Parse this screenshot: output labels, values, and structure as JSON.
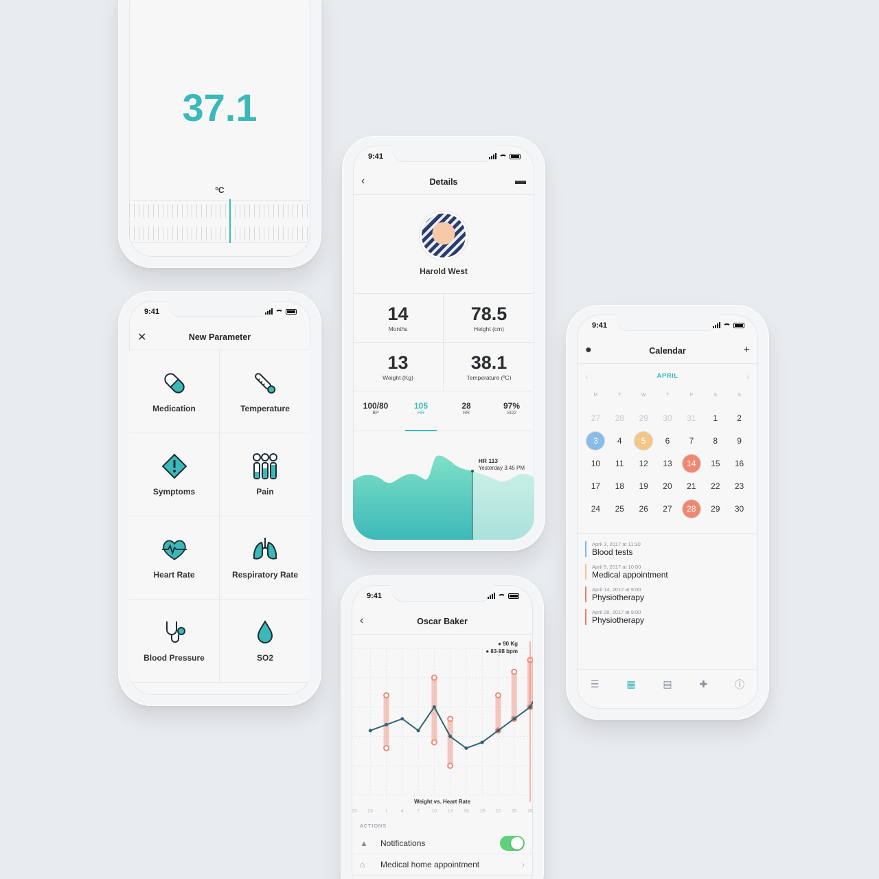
{
  "status_time": "9:41",
  "colors": {
    "accent": "#3bb8b8",
    "coral": "#f08a78",
    "dark_line": "#2f6476",
    "toggle": "#5fd17a"
  },
  "thermometer": {
    "value": "37.1",
    "unit": "ºC"
  },
  "new_parameter": {
    "title": "New Parameter",
    "close_icon": "close-icon",
    "items": [
      {
        "label": "Medication",
        "icon": "pill-icon"
      },
      {
        "label": "Temperature",
        "icon": "thermometer-icon"
      },
      {
        "label": "Symptoms",
        "icon": "warning-icon"
      },
      {
        "label": "Pain",
        "icon": "pain-scale-icon"
      },
      {
        "label": "Heart Rate",
        "icon": "heart-rate-icon"
      },
      {
        "label": "Respiratory Rate",
        "icon": "lungs-icon"
      },
      {
        "label": "Blood Pressure",
        "icon": "stethoscope-icon"
      },
      {
        "label": "SO2",
        "icon": "drop-icon"
      }
    ]
  },
  "details": {
    "title": "Details",
    "patient_name": "Harold West",
    "stats": [
      {
        "value": "14",
        "label": "Months"
      },
      {
        "value": "78.5",
        "label": "Height (cm)"
      },
      {
        "value": "13",
        "label": "Weight (Kg)"
      },
      {
        "value": "38.1",
        "label": "Temperature (ºC)"
      }
    ],
    "vitals": [
      {
        "value": "100/80",
        "label": "BP"
      },
      {
        "value": "105",
        "label": "HR"
      },
      {
        "value": "28",
        "label": "RR"
      },
      {
        "value": "97%",
        "label": "SO2"
      }
    ],
    "hr_marker": {
      "label": "HR 113",
      "time": "Yesterday 3:45 PM"
    }
  },
  "calendar": {
    "title": "Calendar",
    "month": "APRIL",
    "weekdays": [
      "M",
      "T",
      "W",
      "T",
      "F",
      "S",
      "S"
    ],
    "days": [
      "27",
      "28",
      "29",
      "30",
      "31",
      "1",
      "2",
      "3",
      "4",
      "5",
      "6",
      "7",
      "8",
      "9",
      "10",
      "11",
      "12",
      "13",
      "14",
      "15",
      "16",
      "17",
      "18",
      "19",
      "20",
      "21",
      "22",
      "23",
      "24",
      "25",
      "26",
      "27",
      "28",
      "29",
      "30"
    ],
    "events": [
      {
        "date": "April 3, 2017 at 11:30",
        "title": "Blood tests",
        "color": "#7cb6e8"
      },
      {
        "date": "April 5, 2017 at 10:00",
        "title": "Medical appointment",
        "color": "#f3c27a"
      },
      {
        "date": "April 14, 2017 at 9:00",
        "title": "Physiotherapy",
        "color": "#ee7d63"
      },
      {
        "date": "April 28, 2017 at 9:00",
        "title": "Physiotherapy",
        "color": "#ee7d63"
      }
    ]
  },
  "oscar": {
    "title": "Oscar Baker",
    "legend": [
      "90 Kg",
      "83-98 bpm"
    ],
    "chart_title": "Weight vs. Heart Rate",
    "x_ticks": [
      "25",
      "28",
      "1",
      "4",
      "7",
      "10",
      "13",
      "16",
      "19",
      "22",
      "25",
      "28"
    ],
    "actions_header": "ACTIONS",
    "actions": [
      {
        "label": "Notifications",
        "icon": "bell-icon",
        "toggle": "on"
      },
      {
        "label": "Medical home appointment",
        "icon": "home-icon"
      }
    ]
  },
  "chart_data": {
    "type": "line",
    "title": "Weight vs. Heart Rate",
    "categories": [
      "25",
      "28",
      "1",
      "4",
      "7",
      "10",
      "13",
      "16",
      "19",
      "22",
      "25",
      "28"
    ],
    "series": [
      {
        "name": "Weight",
        "values": [
          null,
          86,
          87,
          88,
          86,
          90,
          85,
          83,
          84,
          86,
          88,
          90
        ]
      },
      {
        "name": "Heart Rate",
        "ranges": [
          [
            null,
            null
          ],
          [
            null,
            null
          ],
          [
            83,
            92
          ],
          [
            null,
            null
          ],
          [
            null,
            null
          ],
          [
            84,
            95
          ],
          [
            80,
            88
          ],
          [
            null,
            null
          ],
          [
            null,
            null
          ],
          [
            86,
            92
          ],
          [
            88,
            96
          ],
          [
            90,
            98
          ]
        ]
      }
    ]
  }
}
